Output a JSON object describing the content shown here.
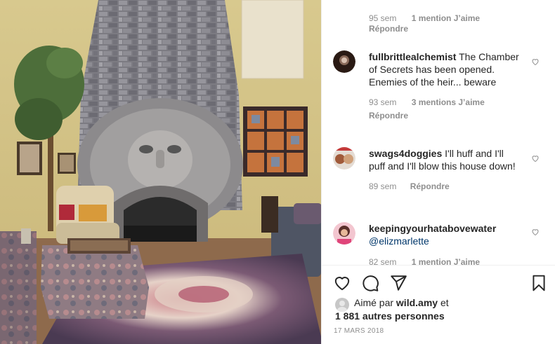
{
  "post": {
    "image_alt": "Stone fireplace carved as a giant face in a living room"
  },
  "top_comment_meta": {
    "time": "95 sem",
    "likes": "1 mention J’aime",
    "reply": "Répondre"
  },
  "comments": [
    {
      "username": "fullbrittlealchemist",
      "text": "The Chamber of Secrets has been opened. Enemies of the heir... beware",
      "time": "93 sem",
      "likes": "3 mentions J’aime",
      "reply": "Répondre"
    },
    {
      "username": "swags4doggies",
      "text": "I'll huff and I'll puff and I'll blow this house down!",
      "time": "89 sem",
      "reply": "Répondre"
    },
    {
      "username": "keepingyourhatabovewater",
      "mention": "@elizmarlette",
      "time": "82 sem",
      "likes": "1 mention J’aime"
    }
  ],
  "actions": {
    "like_icon": "heart-icon",
    "comment_icon": "comment-icon",
    "share_icon": "paper-plane-icon",
    "save_icon": "bookmark-icon"
  },
  "likes_summary": {
    "prefix": "Aimé par",
    "user": "wild.amy",
    "conjunction": "et",
    "others": "1 881 autres personnes"
  },
  "date": "17 MARS 2018",
  "colors": {
    "text": "#262626",
    "secondary": "#8e8e8e",
    "link": "#00376b",
    "border": "#efefef"
  }
}
